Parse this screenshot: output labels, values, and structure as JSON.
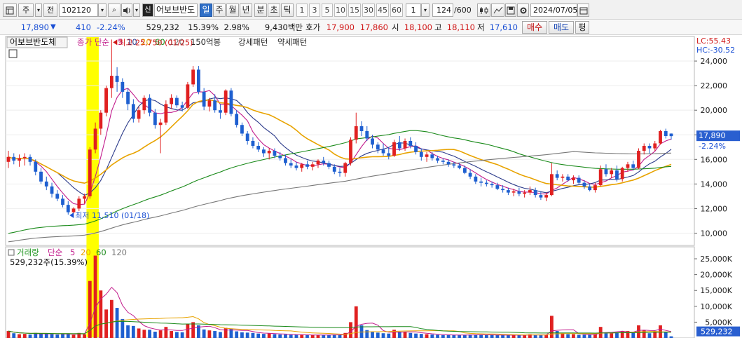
{
  "toolbar": {
    "mode_label": "주",
    "prev_label": "전",
    "code": "102120",
    "stock_name": "어보브반도",
    "periods": [
      "일",
      "주",
      "월",
      "년",
      "분",
      "초",
      "틱"
    ],
    "active_period": "일",
    "intervals": [
      "1",
      "3",
      "5",
      "10",
      "15",
      "30",
      "45",
      "60"
    ],
    "interval_value": "1",
    "count": "124",
    "count_max": "/600",
    "date": "2024/07/05"
  },
  "quote": {
    "price": "17,890",
    "change": "410",
    "change_pct": "-2.24%",
    "volume": "529,232",
    "turnover_pct": "15.39%",
    "volume_ratio": "2.98%",
    "amount": "9,430백만",
    "ask_label": "호가",
    "ask": "17,900",
    "bid": "17,860",
    "open_label": "시",
    "open": "18,100",
    "high_label": "고",
    "high": "18,110",
    "low_label": "저",
    "low": "17,610",
    "buy_label": "매수",
    "sell_label": "매도",
    "eval_label": "평"
  },
  "price_panel": {
    "name": "어보브반도체",
    "legend": [
      {
        "text": "종가 단순",
        "color": "#c21c8c"
      },
      {
        "text": "5",
        "color": "#c21c8c"
      },
      {
        "text": "10",
        "color": "#2b3a8a"
      },
      {
        "text": "20",
        "color": "#e8a300"
      },
      {
        "text": "60",
        "color": "#1a8a1a"
      },
      {
        "text": "120",
        "color": "#777777"
      }
    ],
    "extra_labels": [
      "150억봉",
      "강세패턴",
      "약세패턴"
    ],
    "max_label": "최고 25,750 (01/25)",
    "min_label": "최저 11,510 (01/18)",
    "lc": "LC:55.43",
    "hc": "HC:-30.52",
    "y_ticks": [
      "24,000",
      "22,000",
      "20,000",
      "18,000",
      "16,000",
      "14,000",
      "12,000",
      "10,000"
    ],
    "last_price": "17,890",
    "last_pct": "-2.24%"
  },
  "volume_panel": {
    "legend": [
      {
        "text": "거래량",
        "color": "#2a9a2a"
      },
      {
        "text": "단순",
        "color": "#c21c8c"
      },
      {
        "text": "5",
        "color": "#c21c8c"
      },
      {
        "text": "20",
        "color": "#e8a300"
      },
      {
        "text": "60",
        "color": "#1a8a1a"
      },
      {
        "text": "120",
        "color": "#777777"
      }
    ],
    "value_text": "529,232주(15.39%)",
    "y_ticks": [
      "25,000K",
      "20,000K",
      "15,000K",
      "10,000K",
      "5,000K"
    ],
    "last_volume": "529,232",
    "last_pct": "15.39%"
  },
  "colors": {
    "up": "#e02020",
    "down": "#1e5fd0",
    "highlight": "#ffff00"
  },
  "chart_data": {
    "type": "candlestick",
    "title": "어보브반도체",
    "ylim": [
      9000,
      26000
    ],
    "volume_ylim": [
      0,
      27000
    ],
    "volume_unit": "K",
    "candles": [
      [
        15800,
        16700,
        15300,
        16200,
        2200
      ],
      [
        16200,
        16500,
        15600,
        15900,
        1500
      ],
      [
        15900,
        16400,
        15400,
        16100,
        1200
      ],
      [
        16100,
        16500,
        15500,
        16200,
        1300
      ],
      [
        16200,
        16400,
        15500,
        15800,
        1100
      ],
      [
        15800,
        16000,
        14700,
        15000,
        1600
      ],
      [
        15000,
        15300,
        14000,
        14200,
        1400
      ],
      [
        14200,
        14600,
        13500,
        13800,
        1300
      ],
      [
        13800,
        14100,
        12900,
        13200,
        1200
      ],
      [
        13200,
        13500,
        12600,
        12800,
        1100
      ],
      [
        12800,
        13100,
        12100,
        12300,
        1300
      ],
      [
        12300,
        12600,
        11510,
        11700,
        1400
      ],
      [
        11700,
        12100,
        11600,
        12000,
        1000
      ],
      [
        12000,
        13000,
        11800,
        12800,
        1600
      ],
      [
        12800,
        13200,
        12400,
        13000,
        1200
      ],
      [
        13000,
        17000,
        12800,
        16800,
        18000
      ],
      [
        16800,
        19000,
        16500,
        18500,
        26000
      ],
      [
        18500,
        20000,
        18000,
        19800,
        15000
      ],
      [
        19800,
        22000,
        19500,
        21800,
        9000
      ],
      [
        21800,
        25750,
        21000,
        22800,
        12000
      ],
      [
        22800,
        23500,
        21500,
        22300,
        9500
      ],
      [
        22300,
        22600,
        21000,
        21500,
        6000
      ],
      [
        21500,
        21800,
        20000,
        20500,
        4000
      ],
      [
        20500,
        20900,
        19000,
        19300,
        3800
      ],
      [
        19300,
        20300,
        19000,
        20000,
        3000
      ],
      [
        20000,
        21200,
        19700,
        21000,
        2600
      ],
      [
        21000,
        21300,
        19500,
        19800,
        2600
      ],
      [
        19800,
        20100,
        18500,
        18800,
        2000
      ],
      [
        18800,
        19300,
        16500,
        19000,
        2400
      ],
      [
        19000,
        20800,
        18800,
        20500,
        3500
      ],
      [
        20500,
        21300,
        20100,
        21000,
        2200
      ],
      [
        21000,
        21200,
        20200,
        20400,
        1900
      ],
      [
        20400,
        20700,
        19900,
        20200,
        1800
      ],
      [
        20200,
        22300,
        20100,
        22100,
        4500
      ],
      [
        22100,
        23600,
        21900,
        23300,
        5000
      ],
      [
        23300,
        23600,
        21300,
        21500,
        4000
      ],
      [
        21500,
        21800,
        20000,
        20300,
        2700
      ],
      [
        20300,
        21000,
        19900,
        20800,
        2400
      ],
      [
        20800,
        21300,
        19800,
        20000,
        2200
      ],
      [
        20000,
        20500,
        19300,
        19800,
        1900
      ],
      [
        19800,
        21700,
        19600,
        21600,
        3200
      ],
      [
        21600,
        21800,
        19500,
        19700,
        3000
      ],
      [
        19700,
        20000,
        18600,
        18800,
        2100
      ],
      [
        18800,
        19000,
        17900,
        18100,
        1800
      ],
      [
        18100,
        18300,
        17200,
        17500,
        1700
      ],
      [
        17500,
        17800,
        16900,
        17100,
        1600
      ],
      [
        17100,
        17400,
        16600,
        16800,
        1400
      ],
      [
        16800,
        17000,
        16200,
        16500,
        1300
      ],
      [
        16500,
        16900,
        16000,
        16700,
        1500
      ],
      [
        16700,
        16900,
        16100,
        16300,
        1200
      ],
      [
        16300,
        16600,
        15900,
        16100,
        1100
      ],
      [
        16100,
        16400,
        15500,
        15700,
        1100
      ],
      [
        15700,
        16000,
        15300,
        15500,
        1000
      ],
      [
        15500,
        15800,
        15100,
        15300,
        1000
      ],
      [
        15300,
        15700,
        15000,
        15600,
        1000
      ],
      [
        15600,
        15900,
        15200,
        15400,
        900
      ],
      [
        15400,
        15800,
        15100,
        15600,
        900
      ],
      [
        15600,
        16000,
        15300,
        15900,
        1000
      ],
      [
        15900,
        16200,
        15500,
        15700,
        900
      ],
      [
        15700,
        15900,
        15200,
        15400,
        1000
      ],
      [
        15400,
        15600,
        14800,
        15000,
        1100
      ],
      [
        15000,
        15300,
        14600,
        14900,
        1000
      ],
      [
        14900,
        15800,
        14600,
        15700,
        1600
      ],
      [
        15700,
        17800,
        15500,
        17600,
        5000
      ],
      [
        17600,
        19800,
        17300,
        18700,
        10000
      ],
      [
        18700,
        19100,
        17900,
        18300,
        4000
      ],
      [
        18300,
        18700,
        17500,
        17700,
        2500
      ],
      [
        17700,
        18000,
        16900,
        17200,
        2000
      ],
      [
        17200,
        17400,
        16500,
        16800,
        1700
      ],
      [
        16800,
        17300,
        16300,
        16500,
        1500
      ],
      [
        16500,
        17000,
        16000,
        16300,
        1400
      ],
      [
        16300,
        17600,
        16200,
        17400,
        2600
      ],
      [
        17400,
        17900,
        16700,
        16900,
        2000
      ],
      [
        16900,
        17700,
        16700,
        17500,
        2000
      ],
      [
        17500,
        17800,
        16900,
        17100,
        1600
      ],
      [
        17100,
        17400,
        16400,
        16600,
        1400
      ],
      [
        16600,
        16900,
        15900,
        16200,
        1300
      ],
      [
        16200,
        16600,
        15800,
        16400,
        1200
      ],
      [
        16400,
        16600,
        15900,
        16100,
        1100
      ],
      [
        16100,
        16300,
        15700,
        15900,
        1000
      ],
      [
        15900,
        16100,
        15600,
        15800,
        900
      ],
      [
        15800,
        16000,
        15400,
        15600,
        900
      ],
      [
        15600,
        15800,
        15300,
        15500,
        900
      ],
      [
        15500,
        15700,
        15200,
        15300,
        900
      ],
      [
        15300,
        15500,
        14800,
        14900,
        1000
      ],
      [
        14900,
        15200,
        14400,
        14600,
        1100
      ],
      [
        14600,
        14800,
        14000,
        14200,
        1100
      ],
      [
        14200,
        14500,
        13800,
        14100,
        1000
      ],
      [
        14100,
        14300,
        13800,
        14000,
        900
      ],
      [
        14000,
        14200,
        13700,
        13900,
        900
      ],
      [
        13900,
        14100,
        13500,
        13600,
        900
      ],
      [
        13600,
        13900,
        13300,
        13500,
        900
      ],
      [
        13500,
        13700,
        13100,
        13300,
        900
      ],
      [
        13300,
        13600,
        13000,
        13400,
        900
      ],
      [
        13400,
        13700,
        13000,
        13200,
        900
      ],
      [
        13200,
        13500,
        12900,
        13300,
        900
      ],
      [
        13300,
        13800,
        13100,
        13500,
        1200
      ],
      [
        13500,
        13700,
        12900,
        13100,
        1000
      ],
      [
        13100,
        13400,
        12700,
        12900,
        1000
      ],
      [
        12900,
        13300,
        12600,
        13100,
        1000
      ],
      [
        13100,
        15700,
        13000,
        14800,
        7000
      ],
      [
        14800,
        15100,
        14300,
        14500,
        2200
      ],
      [
        14500,
        14800,
        14200,
        14600,
        1500
      ],
      [
        14600,
        14800,
        14200,
        14300,
        1200
      ],
      [
        14300,
        14700,
        14000,
        14500,
        1200
      ],
      [
        14500,
        14700,
        14000,
        14100,
        1000
      ],
      [
        14100,
        14300,
        13600,
        13800,
        1000
      ],
      [
        13800,
        14000,
        13400,
        13500,
        1000
      ],
      [
        13500,
        14100,
        13300,
        13900,
        1200
      ],
      [
        13900,
        15500,
        13800,
        15200,
        3500
      ],
      [
        15200,
        15600,
        14600,
        14800,
        1800
      ],
      [
        14800,
        15300,
        14500,
        15100,
        1500
      ],
      [
        15100,
        15500,
        14200,
        14400,
        1800
      ],
      [
        14400,
        15400,
        14200,
        15300,
        2200
      ],
      [
        15300,
        15800,
        15000,
        15600,
        2200
      ],
      [
        15600,
        15900,
        15100,
        15300,
        1600
      ],
      [
        15300,
        16900,
        15200,
        16700,
        4000
      ],
      [
        16700,
        17300,
        16400,
        17100,
        2500
      ],
      [
        17100,
        17300,
        16500,
        16900,
        1500
      ],
      [
        16900,
        17500,
        16700,
        17300,
        2000
      ],
      [
        17300,
        18400,
        17200,
        18300,
        4000
      ],
      [
        18300,
        18500,
        17700,
        17900,
        2000
      ],
      [
        18100,
        18110,
        17610,
        17890,
        529
      ]
    ],
    "series_periods": [
      5,
      10,
      20,
      60,
      120
    ]
  }
}
